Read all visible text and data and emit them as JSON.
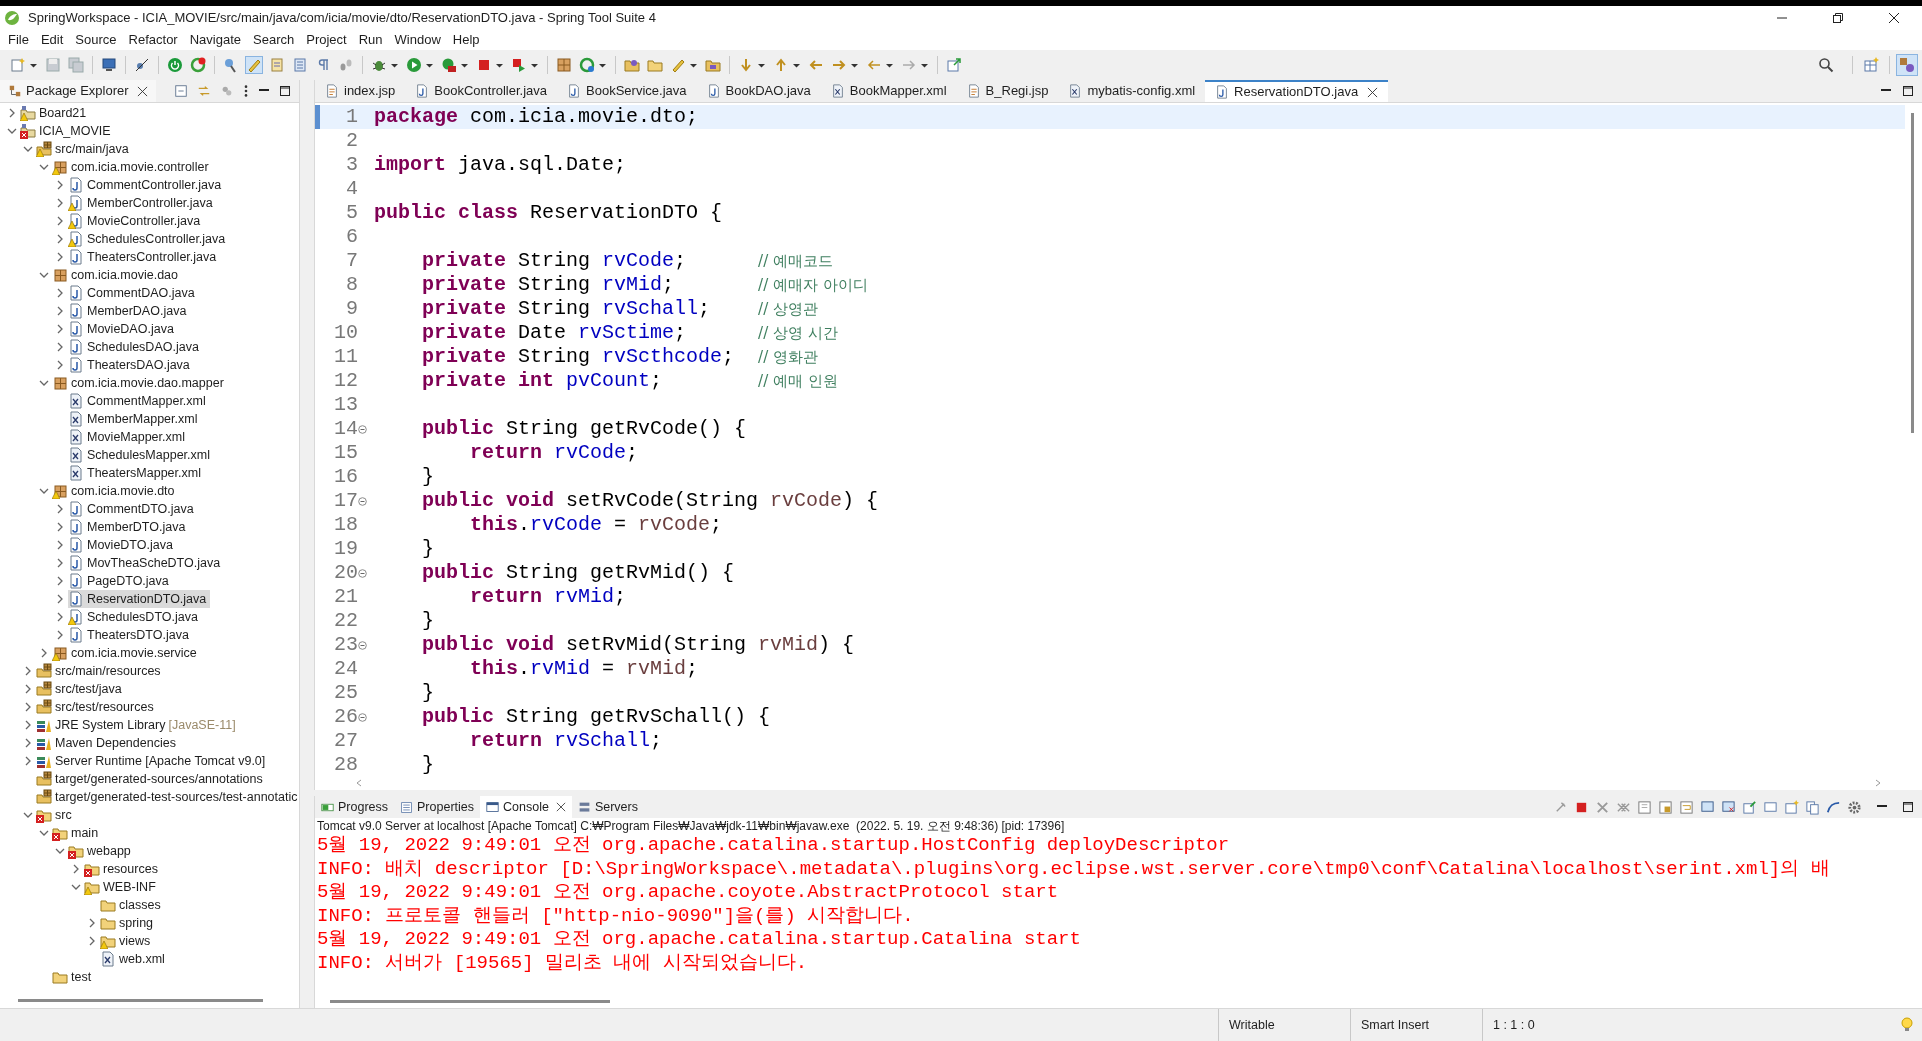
{
  "window": {
    "title": "SpringWorkspace - ICIA_MOVIE/src/main/java/com/icia/movie/dto/ReservationDTO.java - Spring Tool Suite 4"
  },
  "menu": [
    "File",
    "Edit",
    "Source",
    "Refactor",
    "Navigate",
    "Search",
    "Project",
    "Run",
    "Window",
    "Help"
  ],
  "package_explorer": {
    "title": "Package Explorer",
    "tree": [
      {
        "label": "Board21",
        "kind": "project",
        "expanded": false,
        "selected": false,
        "warning": true,
        "error": false
      },
      {
        "label": "ICIA_MOVIE",
        "kind": "project",
        "expanded": true,
        "selected": false,
        "warning": false,
        "error": true,
        "children": [
          {
            "label": "src/main/java",
            "kind": "source-folder",
            "expanded": true,
            "selected": false,
            "warning": true,
            "error": false,
            "children": [
              {
                "label": "com.icia.movie.controller",
                "kind": "package",
                "expanded": true,
                "selected": false,
                "warning": true,
                "error": false,
                "children": [
                  {
                    "label": "CommentController.java",
                    "kind": "java",
                    "expanded": false,
                    "selected": false,
                    "warning": false,
                    "error": false
                  },
                  {
                    "label": "MemberController.java",
                    "kind": "java",
                    "expanded": false,
                    "selected": false,
                    "warning": true,
                    "error": false
                  },
                  {
                    "label": "MovieController.java",
                    "kind": "java",
                    "expanded": false,
                    "selected": false,
                    "warning": true,
                    "error": false
                  },
                  {
                    "label": "SchedulesController.java",
                    "kind": "java",
                    "expanded": false,
                    "selected": false,
                    "warning": true,
                    "error": false
                  },
                  {
                    "label": "TheatersController.java",
                    "kind": "java",
                    "expanded": false,
                    "selected": false,
                    "warning": false,
                    "error": false
                  }
                ]
              },
              {
                "label": "com.icia.movie.dao",
                "kind": "package",
                "expanded": true,
                "selected": false,
                "warning": false,
                "error": false,
                "children": [
                  {
                    "label": "CommentDAO.java",
                    "kind": "java",
                    "expanded": false,
                    "selected": false,
                    "warning": false,
                    "error": false
                  },
                  {
                    "label": "MemberDAO.java",
                    "kind": "java",
                    "expanded": false,
                    "selected": false,
                    "warning": false,
                    "error": false
                  },
                  {
                    "label": "MovieDAO.java",
                    "kind": "java",
                    "expanded": false,
                    "selected": false,
                    "warning": false,
                    "error": false
                  },
                  {
                    "label": "SchedulesDAO.java",
                    "kind": "java",
                    "expanded": false,
                    "selected": false,
                    "warning": false,
                    "error": false
                  },
                  {
                    "label": "TheatersDAO.java",
                    "kind": "java",
                    "expanded": false,
                    "selected": false,
                    "warning": false,
                    "error": false
                  }
                ]
              },
              {
                "label": "com.icia.movie.dao.mapper",
                "kind": "package",
                "expanded": true,
                "selected": false,
                "warning": false,
                "error": false,
                "children": [
                  {
                    "label": "CommentMapper.xml",
                    "kind": "xml",
                    "selected": false,
                    "warning": false,
                    "error": false
                  },
                  {
                    "label": "MemberMapper.xml",
                    "kind": "xml",
                    "selected": false,
                    "warning": false,
                    "error": false
                  },
                  {
                    "label": "MovieMapper.xml",
                    "kind": "xml",
                    "selected": false,
                    "warning": false,
                    "error": false
                  },
                  {
                    "label": "SchedulesMapper.xml",
                    "kind": "xml",
                    "selected": false,
                    "warning": false,
                    "error": false
                  },
                  {
                    "label": "TheatersMapper.xml",
                    "kind": "xml",
                    "selected": false,
                    "warning": false,
                    "error": false
                  }
                ]
              },
              {
                "label": "com.icia.movie.dto",
                "kind": "package",
                "expanded": true,
                "selected": false,
                "warning": true,
                "error": false,
                "children": [
                  {
                    "label": "CommentDTO.java",
                    "kind": "java",
                    "expanded": false,
                    "selected": false,
                    "warning": false,
                    "error": false
                  },
                  {
                    "label": "MemberDTO.java",
                    "kind": "java",
                    "expanded": false,
                    "selected": false,
                    "warning": false,
                    "error": false
                  },
                  {
                    "label": "MovieDTO.java",
                    "kind": "java",
                    "expanded": false,
                    "selected": false,
                    "warning": false,
                    "error": false
                  },
                  {
                    "label": "MovTheaScheDTO.java",
                    "kind": "java",
                    "expanded": false,
                    "selected": false,
                    "warning": false,
                    "error": false
                  },
                  {
                    "label": "PageDTO.java",
                    "kind": "java",
                    "expanded": false,
                    "selected": false,
                    "warning": false,
                    "error": false
                  },
                  {
                    "label": "ReservationDTO.java",
                    "kind": "java",
                    "expanded": false,
                    "selected": true,
                    "warning": false,
                    "error": false
                  },
                  {
                    "label": "SchedulesDTO.java",
                    "kind": "java",
                    "expanded": false,
                    "selected": false,
                    "warning": true,
                    "error": false
                  },
                  {
                    "label": "TheatersDTO.java",
                    "kind": "java",
                    "expanded": false,
                    "selected": false,
                    "warning": false,
                    "error": false
                  }
                ]
              },
              {
                "label": "com.icia.movie.service",
                "kind": "package",
                "expanded": false,
                "selected": false,
                "warning": true,
                "error": false
              }
            ]
          },
          {
            "label": "src/main/resources",
            "kind": "source-folder",
            "expanded": false,
            "selected": false,
            "warning": false,
            "error": false
          },
          {
            "label": "src/test/java",
            "kind": "source-folder",
            "expanded": false,
            "selected": false,
            "warning": false,
            "error": false
          },
          {
            "label": "src/test/resources",
            "kind": "source-folder",
            "expanded": false,
            "selected": false,
            "warning": false,
            "error": false
          },
          {
            "label": "JRE System Library",
            "detail": "[JavaSE-11]",
            "kind": "library",
            "expanded": false,
            "selected": false,
            "warning": false,
            "error": false
          },
          {
            "label": "Maven Dependencies",
            "kind": "library",
            "expanded": false,
            "selected": false,
            "warning": false,
            "error": false
          },
          {
            "label": "Server Runtime [Apache Tomcat v9.0]",
            "kind": "library",
            "expanded": false,
            "selected": false,
            "warning": false,
            "error": false
          },
          {
            "label": "target/generated-sources/annotations",
            "kind": "source-folder",
            "selected": false,
            "warning": false,
            "error": false
          },
          {
            "label": "target/generated-test-sources/test-annotatic",
            "kind": "source-folder",
            "selected": false,
            "warning": false,
            "error": false
          },
          {
            "label": "src",
            "kind": "folder",
            "expanded": true,
            "selected": false,
            "warning": false,
            "error": true,
            "children": [
              {
                "label": "main",
                "kind": "folder",
                "expanded": true,
                "selected": false,
                "warning": false,
                "error": true,
                "children": [
                  {
                    "label": "webapp",
                    "kind": "folder",
                    "expanded": true,
                    "selected": false,
                    "warning": false,
                    "error": true,
                    "children": [
                      {
                        "label": "resources",
                        "kind": "folder",
                        "expanded": false,
                        "selected": false,
                        "warning": false,
                        "error": true
                      },
                      {
                        "label": "WEB-INF",
                        "kind": "folder",
                        "expanded": true,
                        "selected": false,
                        "warning": true,
                        "error": false,
                        "children": [
                          {
                            "label": "classes",
                            "kind": "folder",
                            "selected": false,
                            "warning": false,
                            "error": false
                          },
                          {
                            "label": "spring",
                            "kind": "folder",
                            "expanded": false,
                            "selected": false,
                            "warning": false,
                            "error": false
                          },
                          {
                            "label": "views",
                            "kind": "folder",
                            "expanded": false,
                            "selected": false,
                            "warning": true,
                            "error": false
                          },
                          {
                            "label": "web.xml",
                            "kind": "xml",
                            "selected": false,
                            "warning": false,
                            "error": false
                          }
                        ]
                      }
                    ]
                  }
                ]
              },
              {
                "label": "test",
                "kind": "folder",
                "selected": false,
                "warning": false,
                "error": false
              }
            ]
          }
        ]
      }
    ]
  },
  "editor": {
    "tabs": [
      {
        "label": "index.jsp",
        "kind": "jsp",
        "selected": false
      },
      {
        "label": "BookController.java",
        "kind": "java",
        "selected": false
      },
      {
        "label": "BookService.java",
        "kind": "java",
        "selected": false
      },
      {
        "label": "BookDAO.java",
        "kind": "java",
        "selected": false
      },
      {
        "label": "BookMapper.xml",
        "kind": "xml",
        "selected": false
      },
      {
        "label": "B_Regi.jsp",
        "kind": "jsp",
        "selected": false
      },
      {
        "label": "mybatis-config.xml",
        "kind": "xml",
        "selected": false
      },
      {
        "label": "ReservationDTO.java",
        "kind": "java",
        "selected": true
      }
    ],
    "lines": [
      {
        "number": "1",
        "current": true,
        "foldable": false,
        "segments": [
          {
            "kind": "keyword",
            "text": "package"
          },
          {
            "kind": "plain",
            "text": " com.icia.movie.dto;"
          }
        ]
      },
      {
        "number": "2",
        "current": false,
        "foldable": false
      },
      {
        "number": "3",
        "current": false,
        "foldable": false,
        "segments": [
          {
            "kind": "keyword",
            "text": "import"
          },
          {
            "kind": "plain",
            "text": " java.sql.Date;"
          }
        ]
      },
      {
        "number": "4",
        "current": false,
        "foldable": false
      },
      {
        "number": "5",
        "current": false,
        "foldable": false,
        "segments": [
          {
            "kind": "keyword",
            "text": "public class"
          },
          {
            "kind": "plain",
            "text": " ReservationDTO {"
          }
        ]
      },
      {
        "number": "6",
        "current": false,
        "foldable": false
      },
      {
        "number": "7",
        "current": false,
        "foldable": false,
        "segments": [
          {
            "kind": "keyword",
            "text": "    private"
          },
          {
            "kind": "plain",
            "text": " String "
          },
          {
            "kind": "field",
            "text": "rvCode"
          },
          {
            "kind": "plain",
            "text": ";      "
          },
          {
            "kind": "comment",
            "text": "// 예매코드"
          }
        ]
      },
      {
        "number": "8",
        "current": false,
        "foldable": false,
        "segments": [
          {
            "kind": "keyword",
            "text": "    private"
          },
          {
            "kind": "plain",
            "text": " String "
          },
          {
            "kind": "field",
            "text": "rvMid"
          },
          {
            "kind": "plain",
            "text": ";       "
          },
          {
            "kind": "comment",
            "text": "// 예매자 아이디"
          }
        ]
      },
      {
        "number": "9",
        "current": false,
        "foldable": false,
        "segments": [
          {
            "kind": "keyword",
            "text": "    private"
          },
          {
            "kind": "plain",
            "text": " String "
          },
          {
            "kind": "field",
            "text": "rvSchall"
          },
          {
            "kind": "plain",
            "text": ";    "
          },
          {
            "kind": "comment",
            "text": "// 상영관"
          }
        ]
      },
      {
        "number": "10",
        "current": false,
        "foldable": false,
        "segments": [
          {
            "kind": "keyword",
            "text": "    private"
          },
          {
            "kind": "plain",
            "text": " Date "
          },
          {
            "kind": "field",
            "text": "rvSctime"
          },
          {
            "kind": "plain",
            "text": ";      "
          },
          {
            "kind": "comment",
            "text": "// 상영 시간"
          }
        ]
      },
      {
        "number": "11",
        "current": false,
        "foldable": false,
        "segments": [
          {
            "kind": "keyword",
            "text": "    private"
          },
          {
            "kind": "plain",
            "text": " String "
          },
          {
            "kind": "field",
            "text": "rvScthcode"
          },
          {
            "kind": "plain",
            "text": ";  "
          },
          {
            "kind": "comment",
            "text": "// 영화관"
          }
        ]
      },
      {
        "number": "12",
        "current": false,
        "foldable": false,
        "segments": [
          {
            "kind": "keyword",
            "text": "    private int "
          },
          {
            "kind": "field",
            "text": "pvCount"
          },
          {
            "kind": "plain",
            "text": ";        "
          },
          {
            "kind": "comment",
            "text": "// 예매 인원"
          }
        ]
      },
      {
        "number": "13",
        "current": false,
        "foldable": false
      },
      {
        "number": "14",
        "current": false,
        "foldable": true,
        "segments": [
          {
            "kind": "keyword",
            "text": "    public"
          },
          {
            "kind": "plain",
            "text": " String getRvCode() {"
          }
        ]
      },
      {
        "number": "15",
        "current": false,
        "foldable": false,
        "segments": [
          {
            "kind": "keyword",
            "text": "        return "
          },
          {
            "kind": "field",
            "text": "rvCode"
          },
          {
            "kind": "plain",
            "text": ";"
          }
        ]
      },
      {
        "number": "16",
        "current": false,
        "foldable": false,
        "segments": [
          {
            "kind": "plain",
            "text": "    }"
          }
        ]
      },
      {
        "number": "17",
        "current": false,
        "foldable": true,
        "segments": [
          {
            "kind": "keyword",
            "text": "    public void"
          },
          {
            "kind": "plain",
            "text": " setRvCode(String "
          },
          {
            "kind": "local",
            "text": "rvCode"
          },
          {
            "kind": "plain",
            "text": ") {"
          }
        ]
      },
      {
        "number": "18",
        "current": false,
        "foldable": false,
        "segments": [
          {
            "kind": "keyword",
            "text": "        this"
          },
          {
            "kind": "plain",
            "text": "."
          },
          {
            "kind": "field",
            "text": "rvCode"
          },
          {
            "kind": "plain",
            "text": " = "
          },
          {
            "kind": "local",
            "text": "rvCode"
          },
          {
            "kind": "plain",
            "text": ";"
          }
        ]
      },
      {
        "number": "19",
        "current": false,
        "foldable": false,
        "segments": [
          {
            "kind": "plain",
            "text": "    }"
          }
        ]
      },
      {
        "number": "20",
        "current": false,
        "foldable": true,
        "segments": [
          {
            "kind": "keyword",
            "text": "    public"
          },
          {
            "kind": "plain",
            "text": " String getRvMid() {"
          }
        ]
      },
      {
        "number": "21",
        "current": false,
        "foldable": false,
        "segments": [
          {
            "kind": "keyword",
            "text": "        return "
          },
          {
            "kind": "field",
            "text": "rvMid"
          },
          {
            "kind": "plain",
            "text": ";"
          }
        ]
      },
      {
        "number": "22",
        "current": false,
        "foldable": false,
        "segments": [
          {
            "kind": "plain",
            "text": "    }"
          }
        ]
      },
      {
        "number": "23",
        "current": false,
        "foldable": true,
        "segments": [
          {
            "kind": "keyword",
            "text": "    public void"
          },
          {
            "kind": "plain",
            "text": " setRvMid(String "
          },
          {
            "kind": "local",
            "text": "rvMid"
          },
          {
            "kind": "plain",
            "text": ") {"
          }
        ]
      },
      {
        "number": "24",
        "current": false,
        "foldable": false,
        "segments": [
          {
            "kind": "keyword",
            "text": "        this"
          },
          {
            "kind": "plain",
            "text": "."
          },
          {
            "kind": "field",
            "text": "rvMid"
          },
          {
            "kind": "plain",
            "text": " = "
          },
          {
            "kind": "local",
            "text": "rvMid"
          },
          {
            "kind": "plain",
            "text": ";"
          }
        ]
      },
      {
        "number": "25",
        "current": false,
        "foldable": false,
        "segments": [
          {
            "kind": "plain",
            "text": "    }"
          }
        ]
      },
      {
        "number": "26",
        "current": false,
        "foldable": true,
        "segments": [
          {
            "kind": "keyword",
            "text": "    public"
          },
          {
            "kind": "plain",
            "text": " String getRvSchall() {"
          }
        ]
      },
      {
        "number": "27",
        "current": false,
        "foldable": false,
        "segments": [
          {
            "kind": "keyword",
            "text": "        return "
          },
          {
            "kind": "field",
            "text": "rvSchall"
          },
          {
            "kind": "plain",
            "text": ";"
          }
        ]
      },
      {
        "number": "28",
        "current": false,
        "foldable": false,
        "segments": [
          {
            "kind": "plain",
            "text": "    }"
          }
        ]
      }
    ]
  },
  "bottom_panel": {
    "tabs": [
      {
        "label": "Progress",
        "kind": "progress",
        "selected": false
      },
      {
        "label": "Properties",
        "kind": "properties",
        "selected": false
      },
      {
        "label": "Console",
        "kind": "console",
        "selected": true
      },
      {
        "label": "Servers",
        "kind": "servers",
        "selected": false
      }
    ],
    "console_header": "Tomcat v9.0 Server at localhost [Apache Tomcat] C:₩Program Files₩Java₩jdk-11₩bin₩javaw.exe  (2022. 5. 19. 오전 9:48:36) [pid: 17396]",
    "console_lines": [
      "5월 19, 2022 9:49:01 오전 org.apache.catalina.startup.HostConfig deployDescriptor",
      "INFO: 배치 descriptor [D:\\SpringWorkspace\\.metadata\\.plugins\\org.eclipse.wst.server.core\\tmp0\\conf\\Catalina\\localhost\\serint.xml]의 배",
      "5월 19, 2022 9:49:01 오전 org.apache.coyote.AbstractProtocol start",
      "INFO: 프로토콜 핸들러 [\"http-nio-9090\"]을(를) 시작합니다.",
      "5월 19, 2022 9:49:01 오전 org.apache.catalina.startup.Catalina start",
      "INFO: 서버가 [19565] 밀리초 내에 시작되었습니다."
    ]
  },
  "status_bar": {
    "fields": [
      "Writable",
      "Smart Insert",
      "1 : 1 : 0"
    ]
  }
}
